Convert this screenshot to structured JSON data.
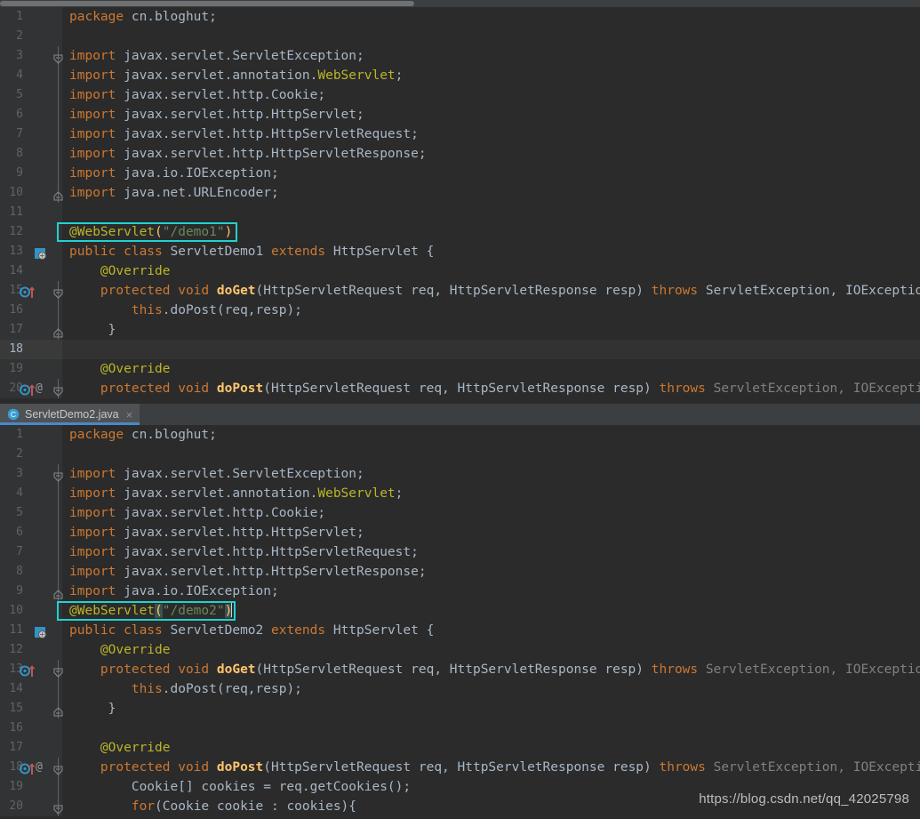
{
  "app": {
    "name": "IntelliJ IDEA Editor",
    "theme": "Darcula",
    "colors": {
      "background": "#2b2b2b",
      "gutter": "#313335",
      "alt_row": "#323232",
      "tabbar": "#3c3f41",
      "tab_active": "#4e5254",
      "tab_underline": "#4a88c7",
      "keyword": "#cc7832",
      "annotation": "#bbb529",
      "string": "#6a8759",
      "identifier": "#a9b7c6",
      "method": "#ffc66d",
      "dimmed": "#808080",
      "line_number": "#606366",
      "highlight_border": "#23d1d1",
      "bracket_match_bg": "#3b514d"
    }
  },
  "top_panel": {
    "scrollbar": {
      "name": "horizontal-scrollbar",
      "thumb_left_pct": 0,
      "thumb_width_pct": 45
    },
    "highlight_box": {
      "label": "@WebServlet(\"/demo1\")",
      "line": 12
    },
    "lines": [
      {
        "n": "1",
        "alt": false,
        "class_marker": false,
        "override_marker": false,
        "at_marker": false,
        "fold": "none",
        "tokens": [
          {
            "t": "package ",
            "c": "kw"
          },
          {
            "t": "cn.bloghut;",
            "c": "plain"
          }
        ]
      },
      {
        "n": "2",
        "alt": false,
        "class_marker": false,
        "override_marker": false,
        "at_marker": false,
        "fold": "none",
        "tokens": []
      },
      {
        "n": "3",
        "alt": false,
        "class_marker": false,
        "override_marker": false,
        "at_marker": false,
        "fold": "open",
        "tokens": [
          {
            "t": "import ",
            "c": "kw"
          },
          {
            "t": "javax.servlet.ServletException;",
            "c": "plain"
          }
        ]
      },
      {
        "n": "4",
        "alt": false,
        "class_marker": false,
        "override_marker": false,
        "at_marker": false,
        "fold": "bar",
        "tokens": [
          {
            "t": "import ",
            "c": "kw"
          },
          {
            "t": "javax.servlet.annotation.",
            "c": "plain"
          },
          {
            "t": "WebServlet",
            "c": "anno"
          },
          {
            "t": ";",
            "c": "plain"
          }
        ]
      },
      {
        "n": "5",
        "alt": false,
        "class_marker": false,
        "override_marker": false,
        "at_marker": false,
        "fold": "bar",
        "tokens": [
          {
            "t": "import ",
            "c": "kw"
          },
          {
            "t": "javax.servlet.http.Cookie;",
            "c": "plain"
          }
        ]
      },
      {
        "n": "6",
        "alt": false,
        "class_marker": false,
        "override_marker": false,
        "at_marker": false,
        "fold": "bar",
        "tokens": [
          {
            "t": "import ",
            "c": "kw"
          },
          {
            "t": "javax.servlet.http.HttpServlet;",
            "c": "plain"
          }
        ]
      },
      {
        "n": "7",
        "alt": false,
        "class_marker": false,
        "override_marker": false,
        "at_marker": false,
        "fold": "bar",
        "tokens": [
          {
            "t": "import ",
            "c": "kw"
          },
          {
            "t": "javax.servlet.http.HttpServletRequest;",
            "c": "plain"
          }
        ]
      },
      {
        "n": "8",
        "alt": false,
        "class_marker": false,
        "override_marker": false,
        "at_marker": false,
        "fold": "bar",
        "tokens": [
          {
            "t": "import ",
            "c": "kw"
          },
          {
            "t": "javax.servlet.http.HttpServletResponse;",
            "c": "plain"
          }
        ]
      },
      {
        "n": "9",
        "alt": false,
        "class_marker": false,
        "override_marker": false,
        "at_marker": false,
        "fold": "bar",
        "tokens": [
          {
            "t": "import ",
            "c": "kw"
          },
          {
            "t": "java.io.IOException;",
            "c": "plain"
          }
        ]
      },
      {
        "n": "10",
        "alt": false,
        "class_marker": false,
        "override_marker": false,
        "at_marker": false,
        "fold": "close",
        "tokens": [
          {
            "t": "import ",
            "c": "kw"
          },
          {
            "t": "java.net.URLEncoder;",
            "c": "plain"
          }
        ]
      },
      {
        "n": "11",
        "alt": false,
        "class_marker": false,
        "override_marker": false,
        "at_marker": false,
        "fold": "none",
        "tokens": []
      },
      {
        "n": "12",
        "alt": false,
        "class_marker": false,
        "override_marker": false,
        "at_marker": false,
        "fold": "none",
        "tokens": [
          {
            "t": "@WebServlet",
            "c": "anno"
          },
          {
            "t": "(",
            "c": "method"
          },
          {
            "t": "\"/demo1\"",
            "c": "str"
          },
          {
            "t": ")",
            "c": "method"
          }
        ]
      },
      {
        "n": "13",
        "alt": false,
        "class_marker": true,
        "override_marker": false,
        "at_marker": false,
        "fold": "none",
        "tokens": [
          {
            "t": "public class ",
            "c": "kw"
          },
          {
            "t": "ServletDemo1",
            "c": "plain"
          },
          {
            "t": " extends ",
            "c": "kw"
          },
          {
            "t": "HttpServlet {",
            "c": "plain"
          }
        ]
      },
      {
        "n": "14",
        "alt": false,
        "class_marker": false,
        "override_marker": false,
        "at_marker": false,
        "fold": "none",
        "tokens": [
          {
            "t": "    @Override",
            "c": "anno"
          }
        ]
      },
      {
        "n": "15",
        "alt": false,
        "class_marker": false,
        "override_marker": true,
        "at_marker": false,
        "fold": "open",
        "tokens": [
          {
            "t": "    protected void ",
            "c": "kw"
          },
          {
            "t": "doGet",
            "c": "method-b"
          },
          {
            "t": "(HttpServletRequest req, HttpServletResponse resp) ",
            "c": "plain"
          },
          {
            "t": "throws ",
            "c": "kw"
          },
          {
            "t": "ServletException, IOException {",
            "c": "plain"
          }
        ]
      },
      {
        "n": "16",
        "alt": false,
        "class_marker": false,
        "override_marker": false,
        "at_marker": false,
        "fold": "bar",
        "tokens": [
          {
            "t": "        ",
            "c": "plain"
          },
          {
            "t": "this",
            "c": "kw"
          },
          {
            "t": ".doPost(req,resp);",
            "c": "plain"
          }
        ]
      },
      {
        "n": "17",
        "alt": false,
        "class_marker": false,
        "override_marker": false,
        "at_marker": false,
        "fold": "close",
        "tokens": [
          {
            "t": "     }",
            "c": "plain"
          }
        ]
      },
      {
        "n": "18",
        "alt": true,
        "class_marker": false,
        "override_marker": false,
        "at_marker": false,
        "fold": "none",
        "tokens": []
      },
      {
        "n": "19",
        "alt": false,
        "class_marker": false,
        "override_marker": false,
        "at_marker": false,
        "fold": "none",
        "tokens": [
          {
            "t": "    @Override",
            "c": "anno"
          }
        ]
      },
      {
        "n": "20",
        "alt": false,
        "class_marker": false,
        "override_marker": true,
        "at_marker": true,
        "fold": "open",
        "tokens": [
          {
            "t": "    protected void ",
            "c": "kw"
          },
          {
            "t": "doPost",
            "c": "method-b"
          },
          {
            "t": "(HttpServletRequest req, HttpServletResponse resp) ",
            "c": "plain"
          },
          {
            "t": "throws ",
            "c": "kw"
          },
          {
            "t": "ServletException, IOException {",
            "c": "dim"
          }
        ]
      }
    ]
  },
  "tab": {
    "name": "ServletDemo2.java",
    "label": "ServletDemo2.java",
    "icon": "java-class-icon",
    "close_glyph": "×",
    "active": true
  },
  "bottom_panel": {
    "scrollbar": {
      "name": "horizontal-scrollbar",
      "thumb_left_pct": 0,
      "thumb_width_pct": 45
    },
    "highlight_box": {
      "label": "@WebServlet(\"/demo2\")",
      "line": 10
    },
    "lines": [
      {
        "n": "1",
        "alt": false,
        "class_marker": false,
        "override_marker": false,
        "at_marker": false,
        "fold": "none",
        "tokens": [
          {
            "t": "package ",
            "c": "kw"
          },
          {
            "t": "cn.bloghut;",
            "c": "plain"
          }
        ]
      },
      {
        "n": "2",
        "alt": false,
        "class_marker": false,
        "override_marker": false,
        "at_marker": false,
        "fold": "none",
        "tokens": []
      },
      {
        "n": "3",
        "alt": false,
        "class_marker": false,
        "override_marker": false,
        "at_marker": false,
        "fold": "open",
        "tokens": [
          {
            "t": "import ",
            "c": "kw"
          },
          {
            "t": "javax.servlet.ServletException;",
            "c": "plain"
          }
        ]
      },
      {
        "n": "4",
        "alt": false,
        "class_marker": false,
        "override_marker": false,
        "at_marker": false,
        "fold": "bar",
        "tokens": [
          {
            "t": "import ",
            "c": "kw"
          },
          {
            "t": "javax.servlet.annotation.",
            "c": "plain"
          },
          {
            "t": "WebServlet",
            "c": "anno"
          },
          {
            "t": ";",
            "c": "plain"
          }
        ]
      },
      {
        "n": "5",
        "alt": false,
        "class_marker": false,
        "override_marker": false,
        "at_marker": false,
        "fold": "bar",
        "tokens": [
          {
            "t": "import ",
            "c": "kw"
          },
          {
            "t": "javax.servlet.http.Cookie;",
            "c": "plain"
          }
        ]
      },
      {
        "n": "6",
        "alt": false,
        "class_marker": false,
        "override_marker": false,
        "at_marker": false,
        "fold": "bar",
        "tokens": [
          {
            "t": "import ",
            "c": "kw"
          },
          {
            "t": "javax.servlet.http.HttpServlet;",
            "c": "plain"
          }
        ]
      },
      {
        "n": "7",
        "alt": false,
        "class_marker": false,
        "override_marker": false,
        "at_marker": false,
        "fold": "bar",
        "tokens": [
          {
            "t": "import ",
            "c": "kw"
          },
          {
            "t": "javax.servlet.http.HttpServletRequest;",
            "c": "plain"
          }
        ]
      },
      {
        "n": "8",
        "alt": false,
        "class_marker": false,
        "override_marker": false,
        "at_marker": false,
        "fold": "bar",
        "tokens": [
          {
            "t": "import ",
            "c": "kw"
          },
          {
            "t": "javax.servlet.http.HttpServletResponse;",
            "c": "plain"
          }
        ]
      },
      {
        "n": "9",
        "alt": false,
        "class_marker": false,
        "override_marker": false,
        "at_marker": false,
        "fold": "close",
        "tokens": [
          {
            "t": "import ",
            "c": "kw"
          },
          {
            "t": "java.io.IOException;",
            "c": "plain"
          }
        ]
      },
      {
        "n": "10",
        "alt": false,
        "class_marker": false,
        "override_marker": false,
        "at_marker": false,
        "fold": "none",
        "caret_at_end": true,
        "tokens": [
          {
            "t": "@WebServlet",
            "c": "anno"
          },
          {
            "t": "(",
            "c": "paren-hl"
          },
          {
            "t": "\"/demo2\"",
            "c": "str"
          },
          {
            "t": ")",
            "c": "paren-hl"
          }
        ]
      },
      {
        "n": "11",
        "alt": false,
        "class_marker": true,
        "override_marker": false,
        "at_marker": false,
        "fold": "none",
        "tokens": [
          {
            "t": "public class ",
            "c": "kw"
          },
          {
            "t": "ServletDemo2",
            "c": "plain"
          },
          {
            "t": " extends ",
            "c": "kw"
          },
          {
            "t": "HttpServlet {",
            "c": "plain"
          }
        ]
      },
      {
        "n": "12",
        "alt": false,
        "class_marker": false,
        "override_marker": false,
        "at_marker": false,
        "fold": "none",
        "tokens": [
          {
            "t": "    @Override",
            "c": "anno"
          }
        ]
      },
      {
        "n": "13",
        "alt": false,
        "class_marker": false,
        "override_marker": true,
        "at_marker": false,
        "fold": "open",
        "tokens": [
          {
            "t": "    protected void ",
            "c": "kw"
          },
          {
            "t": "doGet",
            "c": "method-b"
          },
          {
            "t": "(HttpServletRequest req, HttpServletResponse resp) ",
            "c": "plain"
          },
          {
            "t": "throws ",
            "c": "kw"
          },
          {
            "t": "ServletException, IOException {",
            "c": "dim"
          }
        ]
      },
      {
        "n": "14",
        "alt": false,
        "class_marker": false,
        "override_marker": false,
        "at_marker": false,
        "fold": "bar",
        "tokens": [
          {
            "t": "        ",
            "c": "plain"
          },
          {
            "t": "this",
            "c": "kw"
          },
          {
            "t": ".doPost(req,resp);",
            "c": "plain"
          }
        ]
      },
      {
        "n": "15",
        "alt": false,
        "class_marker": false,
        "override_marker": false,
        "at_marker": false,
        "fold": "close",
        "tokens": [
          {
            "t": "     }",
            "c": "plain"
          }
        ]
      },
      {
        "n": "16",
        "alt": false,
        "class_marker": false,
        "override_marker": false,
        "at_marker": false,
        "fold": "none",
        "tokens": []
      },
      {
        "n": "17",
        "alt": false,
        "class_marker": false,
        "override_marker": false,
        "at_marker": false,
        "fold": "none",
        "tokens": [
          {
            "t": "    @Override",
            "c": "anno"
          }
        ]
      },
      {
        "n": "18",
        "alt": false,
        "class_marker": false,
        "override_marker": true,
        "at_marker": true,
        "fold": "open",
        "tokens": [
          {
            "t": "    protected void ",
            "c": "kw"
          },
          {
            "t": "doPost",
            "c": "method-b"
          },
          {
            "t": "(HttpServletRequest req, HttpServletResponse resp) ",
            "c": "plain"
          },
          {
            "t": "throws ",
            "c": "kw"
          },
          {
            "t": "ServletException, IOException {",
            "c": "dim"
          }
        ]
      },
      {
        "n": "19",
        "alt": false,
        "class_marker": false,
        "override_marker": false,
        "at_marker": false,
        "fold": "bar",
        "tokens": [
          {
            "t": "        Cookie[] cookies = req.getCookies();",
            "c": "plain"
          }
        ]
      },
      {
        "n": "20",
        "alt": false,
        "class_marker": false,
        "override_marker": false,
        "at_marker": false,
        "fold": "open",
        "tokens": [
          {
            "t": "        ",
            "c": "plain"
          },
          {
            "t": "for",
            "c": "kw"
          },
          {
            "t": "(Cookie cookie : cookies){",
            "c": "plain"
          }
        ]
      }
    ]
  },
  "watermark": {
    "text": "https://blog.csdn.net/qq_42025798"
  }
}
